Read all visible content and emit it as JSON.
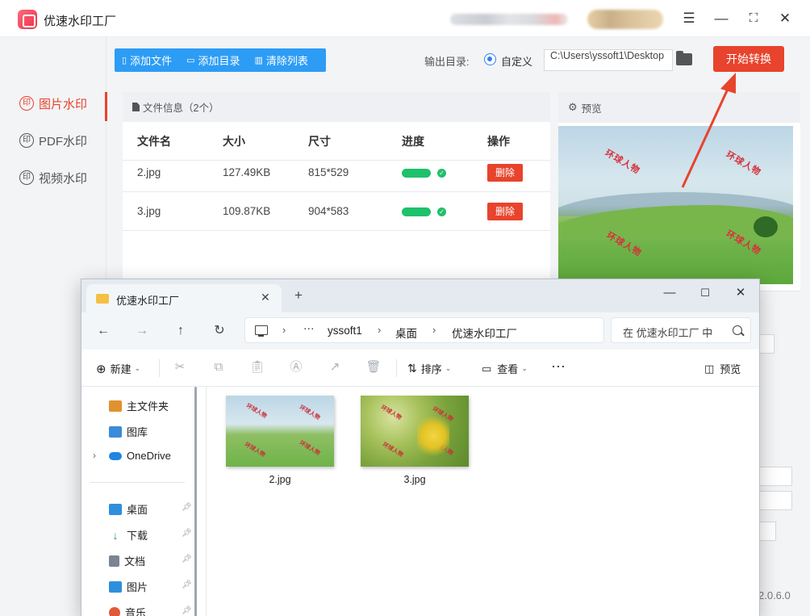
{
  "app": {
    "title": "优速水印工厂",
    "version": "2.0.6.0",
    "window_controls": [
      "menu",
      "minimize",
      "maximize",
      "close"
    ]
  },
  "sidebar": {
    "items": [
      {
        "label": "图片水印",
        "active": true
      },
      {
        "label": "PDF水印",
        "active": false
      },
      {
        "label": "视频水印",
        "active": false
      }
    ]
  },
  "toolbar": {
    "add_file": "添加文件",
    "add_dir": "添加目录",
    "clear_list": "清除列表",
    "output_label": "输出目录:",
    "output_option": "自定义",
    "output_path": "C:\\Users\\yssoft1\\Desktop",
    "start_button": "开始转换"
  },
  "file_panel": {
    "title": "文件信息（2个）",
    "columns": [
      "文件名",
      "大小",
      "尺寸",
      "进度",
      "操作"
    ],
    "rows": [
      {
        "name": "2.jpg",
        "size": "127.49KB",
        "dims": "815*529",
        "progress": 1.0,
        "action": "删除"
      },
      {
        "name": "3.jpg",
        "size": "109.87KB",
        "dims": "904*583",
        "progress": 1.0,
        "action": "删除"
      }
    ]
  },
  "preview": {
    "title": "预览",
    "watermark_text": "环球人物"
  },
  "explorer": {
    "tab_title": "优速水印工厂",
    "breadcrumb": [
      "yssoft1",
      "桌面",
      "优速水印工厂"
    ],
    "search_placeholder": "在 优速水印工厂 中",
    "commands": {
      "new": "新建",
      "sort": "排序",
      "view": "查看",
      "preview": "预览"
    },
    "nav_items": [
      {
        "label": "主文件夹"
      },
      {
        "label": "图库"
      },
      {
        "label": "OneDrive"
      },
      {
        "label": "桌面"
      },
      {
        "label": "下载"
      },
      {
        "label": "文档"
      },
      {
        "label": "图片"
      },
      {
        "label": "音乐"
      }
    ],
    "files": [
      {
        "name": "2.jpg"
      },
      {
        "name": "3.jpg"
      }
    ]
  },
  "colors": {
    "accent_red": "#e8432c",
    "toolbar_blue": "#2d9cf5",
    "progress_green": "#1fc16b"
  }
}
